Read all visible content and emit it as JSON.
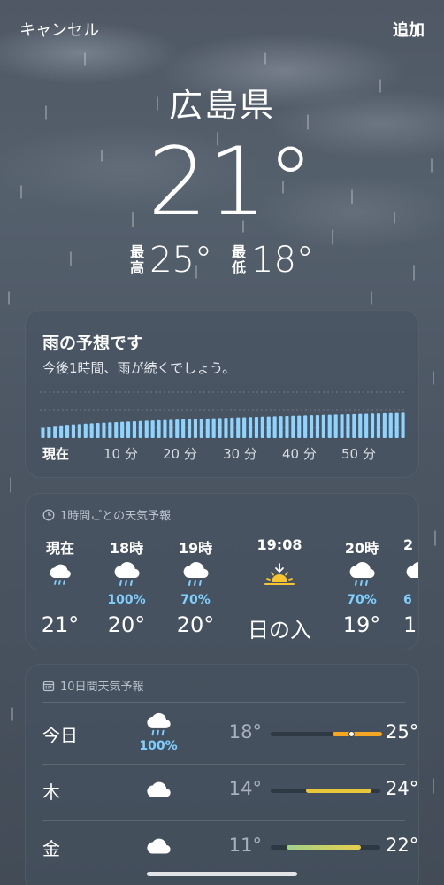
{
  "topbar": {
    "cancel_label": "キャンセル",
    "add_label": "追加"
  },
  "current": {
    "location": "広島県",
    "temperature": "21°",
    "high_label": [
      "最",
      "高"
    ],
    "high": "25°",
    "low_label": [
      "最",
      "低"
    ],
    "low": "18°"
  },
  "rain_forecast": {
    "title": "雨の予想です",
    "subtitle": "今後1時間、雨が続くでしょう。",
    "axis": [
      "現在",
      "10 分",
      "20 分",
      "30 分",
      "40 分",
      "50 分"
    ],
    "intensity_start": 0.22,
    "intensity_end": 0.55,
    "bar_count": 60,
    "color": "#8fd3ff"
  },
  "hourly": {
    "header": "1時間ごとの天気予報",
    "items": [
      {
        "time": "現在",
        "icon": "rain-icon",
        "pop": "",
        "temp": "21°"
      },
      {
        "time": "18時",
        "icon": "rain-icon",
        "pop": "100%",
        "temp": "20°"
      },
      {
        "time": "19時",
        "icon": "rain-icon",
        "pop": "70%",
        "temp": "20°"
      },
      {
        "time": "19:08",
        "icon": "sunset-icon",
        "pop": "",
        "temp": "日の入"
      },
      {
        "time": "20時",
        "icon": "rain-icon",
        "pop": "70%",
        "temp": "19°"
      },
      {
        "time": "2",
        "icon": "rain-icon",
        "pop": "6",
        "temp": "1"
      }
    ]
  },
  "daily": {
    "header": "10日間天気予報",
    "items": [
      {
        "day": "今日",
        "icon": "rain-icon",
        "pop": "100%",
        "low": "18°",
        "high": "25°"
      },
      {
        "day": "木",
        "icon": "cloud-icon",
        "pop": "",
        "low": "14°",
        "high": "24°"
      },
      {
        "day": "金",
        "icon": "cloud-icon",
        "pop": "",
        "low": "11°",
        "high": "22°"
      }
    ]
  },
  "colors": {
    "precip_text": "#7fd0ff",
    "bar_warm": "#f5a623",
    "bar_yellow": "#e8d04a",
    "bar_green": "#9ed28a"
  }
}
